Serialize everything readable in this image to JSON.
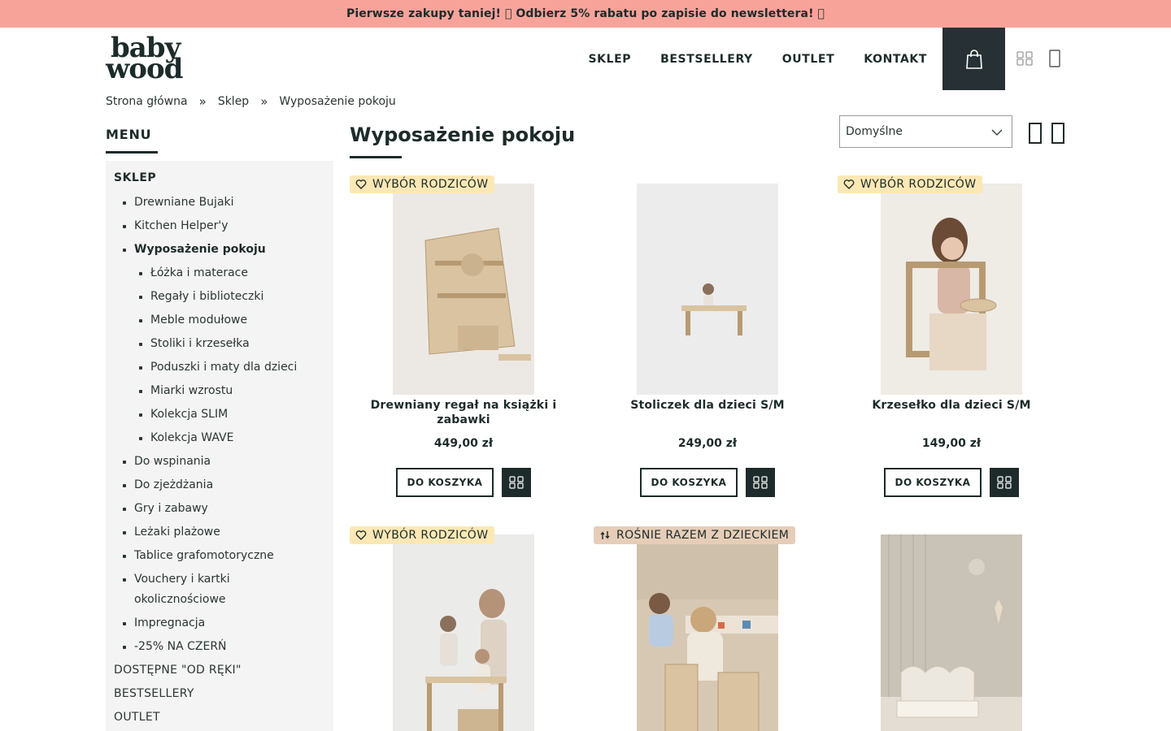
{
  "banner": {
    "text": "Pierwsze zakupy taniej! \u0000 Odbierz 5% rabatu po zapisie do newslettera! \u0000"
  },
  "logo": {
    "line1": "baby",
    "line2": "wood"
  },
  "nav": {
    "items": [
      "SKLEP",
      "BESTSELLERY",
      "OUTLET",
      "KONTAKT"
    ]
  },
  "icons": {
    "cart": "shopping-bag-icon",
    "compare": "compare-grid-icon",
    "account": "user-icon"
  },
  "breadcrumb": {
    "items": [
      "Strona główna",
      "Sklep",
      "Wyposażenie pokoju"
    ],
    "separator": "»"
  },
  "sidebar": {
    "title": "MENU",
    "root": "SKLEP",
    "items": [
      {
        "label": "Drewniane Bujaki",
        "level": 1
      },
      {
        "label": "Kitchen Helper'y",
        "level": 1
      },
      {
        "label": "Wyposażenie pokoju",
        "level": 1,
        "active": true
      },
      {
        "label": "Łóżka i materace",
        "level": 2
      },
      {
        "label": "Regały i biblioteczki",
        "level": 2
      },
      {
        "label": "Meble modułowe",
        "level": 2
      },
      {
        "label": "Stoliki i krzesełka",
        "level": 2
      },
      {
        "label": "Poduszki i maty dla dzieci",
        "level": 2
      },
      {
        "label": "Miarki wzrostu",
        "level": 2
      },
      {
        "label": "Kolekcja SLIM",
        "level": 2
      },
      {
        "label": "Kolekcja WAVE",
        "level": 2
      },
      {
        "label": "Do wspinania",
        "level": 1
      },
      {
        "label": "Do zjeżdżania",
        "level": 1
      },
      {
        "label": "Gry i zabawy",
        "level": 1
      },
      {
        "label": "Leżaki plażowe",
        "level": 1
      },
      {
        "label": "Tablice grafomotoryczne",
        "level": 1
      },
      {
        "label": "Vouchery i kartki okolicznościowe",
        "level": 1
      },
      {
        "label": "Impregnacja",
        "level": 1
      },
      {
        "label": "-25% NA CZERŃ",
        "level": 1
      },
      {
        "label": "DOSTĘPNE \"OD RĘKI\"",
        "level": 0
      },
      {
        "label": "BESTSELLERY",
        "level": 0
      },
      {
        "label": "OUTLET",
        "level": 0
      }
    ]
  },
  "main": {
    "title": "Wyposażenie pokoju",
    "sort": {
      "selected": "Domyślne"
    },
    "add_to_cart_label": "DO KOSZYKA",
    "products": [
      {
        "name": "Drewniany regał na książki i zabawki",
        "price": "449,00 zł",
        "badge": "WYBÓR RODZICÓW",
        "badge_style": "yellow",
        "badge_icon": "heart-icon",
        "image": "bookshelf"
      },
      {
        "name": "Stoliczek dla dzieci S/M",
        "price": "249,00 zł",
        "badge": "",
        "image": "table"
      },
      {
        "name": "Krzesełko dla dzieci S/M",
        "price": "149,00 zł",
        "badge": "WYBÓR RODZICÓW",
        "badge_style": "yellow",
        "badge_icon": "heart-icon",
        "image": "chair"
      },
      {
        "name": "",
        "price": "",
        "badge": "WYBÓR RODZICÓW",
        "badge_style": "yellow",
        "badge_icon": "heart-icon",
        "image": "helper"
      },
      {
        "name": "",
        "price": "",
        "badge": "ROŚNIE RAZEM Z DZIECKIEM",
        "badge_style": "tan",
        "badge_icon": "growth-arrows-icon",
        "image": "kids-table"
      },
      {
        "name": "",
        "price": "",
        "badge": "",
        "image": "bed"
      }
    ]
  },
  "colors": {
    "banner_bg": "#f8a39a",
    "dark": "#1d2b2a",
    "cart_bg": "#273034",
    "sidebar_bg": "#f4f4f4",
    "badge_yellow": "#fbe8b4",
    "badge_tan": "#e6cdb7"
  }
}
